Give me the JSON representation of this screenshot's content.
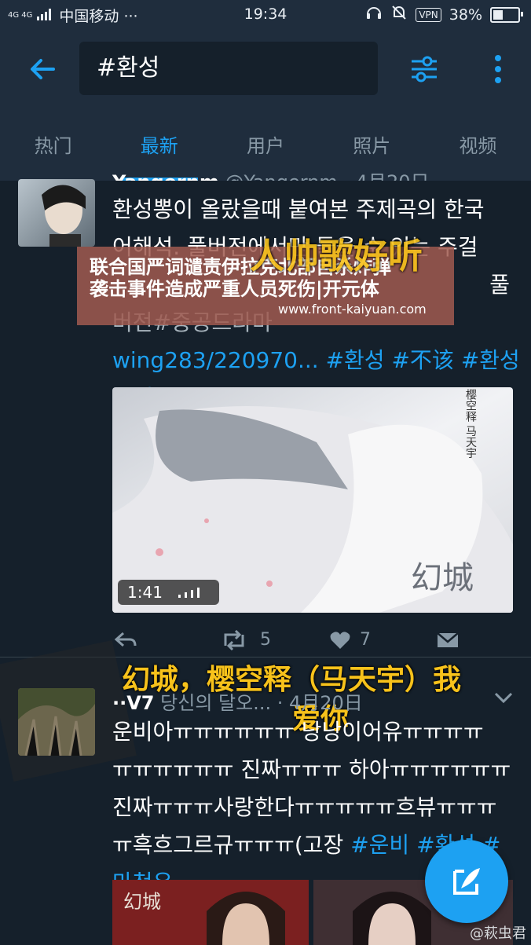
{
  "status": {
    "network": "4G 4G",
    "carrier": "中国移动 ···",
    "time": "19:34",
    "vpn": "VPN",
    "battery": "38%"
  },
  "header": {
    "search_value": "#환성",
    "icons": [
      "back-arrow-icon",
      "filter-sliders-icon",
      "more-vertical-icon"
    ]
  },
  "tabs": [
    {
      "label": "热门"
    },
    {
      "label": "最新"
    },
    {
      "label": "用户"
    },
    {
      "label": "照片"
    },
    {
      "label": "视频"
    }
  ],
  "tweet1": {
    "author_partial": "Yangernm",
    "handle_partial": "@Yangernm · 4月20日",
    "text_line1": "환성뽕이 올랐을때 붙여본 주제곡의 한국",
    "text_line2": "어해석. 풀버전에서만 들을 수 있는 주걸",
    "text_line3_right": "풀",
    "text_line4_partial": "버전#중공드라마",
    "link_line": "wing283/220970...",
    "tags": "#환성 #不该 #환성",
    "tag_line2": "주제곡",
    "video_duration": "1:41",
    "retweets": "5",
    "likes": "7"
  },
  "overlay": {
    "news_line1": "联合国严词谴责伊拉克北部自杀炸弹",
    "news_line2": "袭击事件造成严重人员死伤|开元体",
    "news_url": "www.front-kaiyuan.com",
    "yellow_caption_top": "人帅歌好听",
    "yellow_caption_line1": "幻城，樱空释（马天宇）我",
    "yellow_caption_line2": "爱你",
    "poster_title": "幻城",
    "poster_name": "樱空释 马天宇"
  },
  "tweet2": {
    "name_partial": "··V7",
    "meta": "당신의 달오... · 4月20日",
    "line1": "운비아ㅠㅠㅠㅠㅠㅠ 낭낭이어유ㅠㅠㅠㅠ",
    "line2": "ㅠㅠㅠㅠㅠㅠ 진짜ㅠㅠㅠ 하아ㅠㅠㅠㅠㅠㅠ",
    "line3": "진짜ㅠㅠㅠ사랑한다ㅠㅠㅠㅠㅠ흐뷰ㅠㅠㅠ",
    "line4_text": "ㅠ흑흐그르규ㅠㅠㅠ(고장",
    "line4_tags": "#운비 #환성 #",
    "line5_tag": "마천우",
    "image_title": "幻城"
  },
  "watermark": "@萩虫君",
  "colors": {
    "background": "#15202b",
    "header": "#1f2d3d",
    "accent": "#1da1f2",
    "muted": "#8899a6",
    "caption": "#f7c21b"
  }
}
